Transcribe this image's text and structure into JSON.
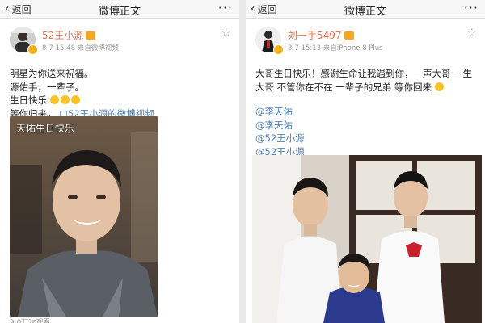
{
  "left": {
    "nav": {
      "back": "返回",
      "title": "微博正文",
      "more": "···"
    },
    "user": {
      "name": "52王小源",
      "time": "8-7 15:48",
      "source": "来自微博视频"
    },
    "text": {
      "line1": "明星为你送来祝福。",
      "line2": "源佑手，一辈子。",
      "line3": "生日快乐",
      "line4_prefix": "等你归来。",
      "line4_link": "□52王小源的微博视频"
    },
    "media_caption": "天佑生日快乐",
    "views": "9.0万次观看"
  },
  "right": {
    "nav": {
      "back": "返回",
      "title": "微博正文",
      "more": "···"
    },
    "user": {
      "name": "刘一手5497",
      "time": "8-7 15:13",
      "source": "来自iPhone 8 Plus"
    },
    "text": {
      "line1": "大哥生日快乐！感谢生命让我遇到你，一声大哥 一生",
      "line2": "大哥 不管你在不在 一辈子的兄弟 等你回来"
    },
    "mentions": [
      "@李天佑",
      "@李天佑",
      "@52王小源",
      "@52王小源"
    ]
  },
  "colors": {
    "accent": "#eb7350",
    "link": "#4d82b8",
    "meta": "#9a9a9a"
  },
  "icons": [
    "chevron-left-icon",
    "more-icon",
    "star-icon",
    "vip-crown-icon",
    "verified-badge-icon",
    "emoji-icon"
  ]
}
